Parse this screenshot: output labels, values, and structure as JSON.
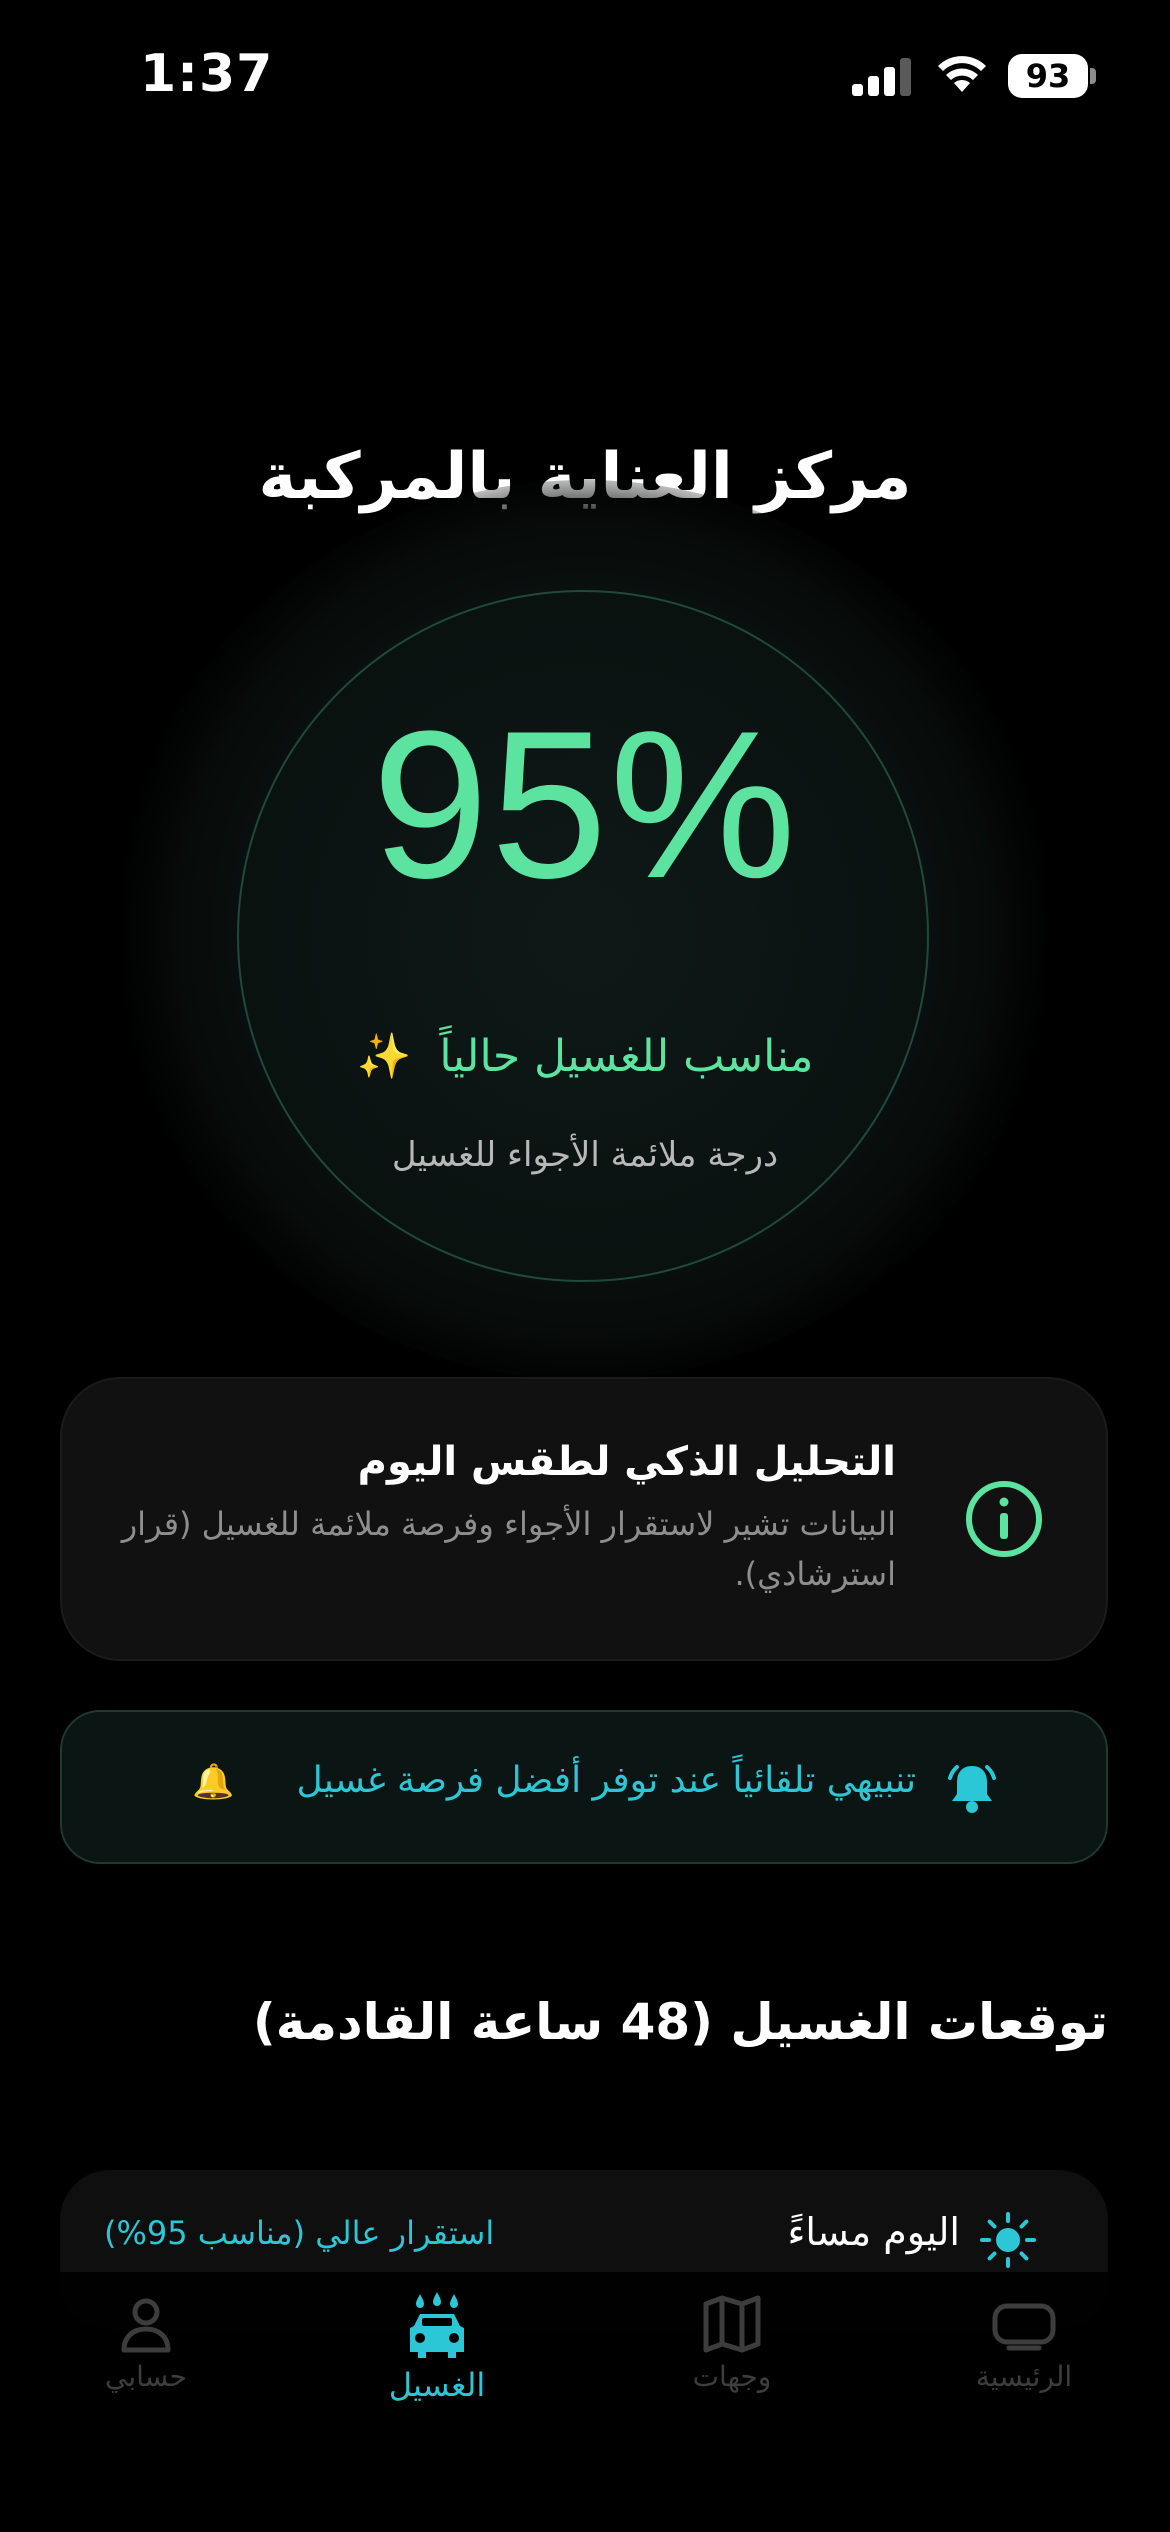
{
  "status_bar": {
    "time": "1:37",
    "battery": "93"
  },
  "page": {
    "title": "مركز العناية بالمركبة"
  },
  "gauge": {
    "percent": "95%",
    "status": "مناسب للغسيل حالياً",
    "sparkle": "✨",
    "caption": "درجة ملائمة الأجواء للغسيل"
  },
  "analysis": {
    "title": "التحليل الذكي لطقس اليوم",
    "body": "البيانات تشير لاستقرار الأجواء وفرصة ملائمة للغسيل (قرار استرشادي)."
  },
  "alert": {
    "label": "تنبيهي تلقائياً عند توفر أفضل فرصة غسيل",
    "emoji": "🔔"
  },
  "forecast": {
    "section_title": "توقعات الغسيل (48 ساعة القادمة)",
    "items": [
      {
        "time": "اليوم مساءً",
        "status": "استقرار عالي (مناسب 95%)",
        "icon": "sun-icon"
      }
    ]
  },
  "tabs": [
    {
      "label": "حسابي",
      "icon": "person-icon"
    },
    {
      "label": "الغسيل",
      "icon": "car-wash-icon",
      "active": true
    },
    {
      "label": "وجهات",
      "icon": "map-icon"
    },
    {
      "label": "الرئيسية",
      "icon": "car-screen-icon"
    }
  ],
  "colors": {
    "accent_green": "#5de3a0",
    "accent_cyan": "#2bc7d6",
    "background": "#000000"
  }
}
